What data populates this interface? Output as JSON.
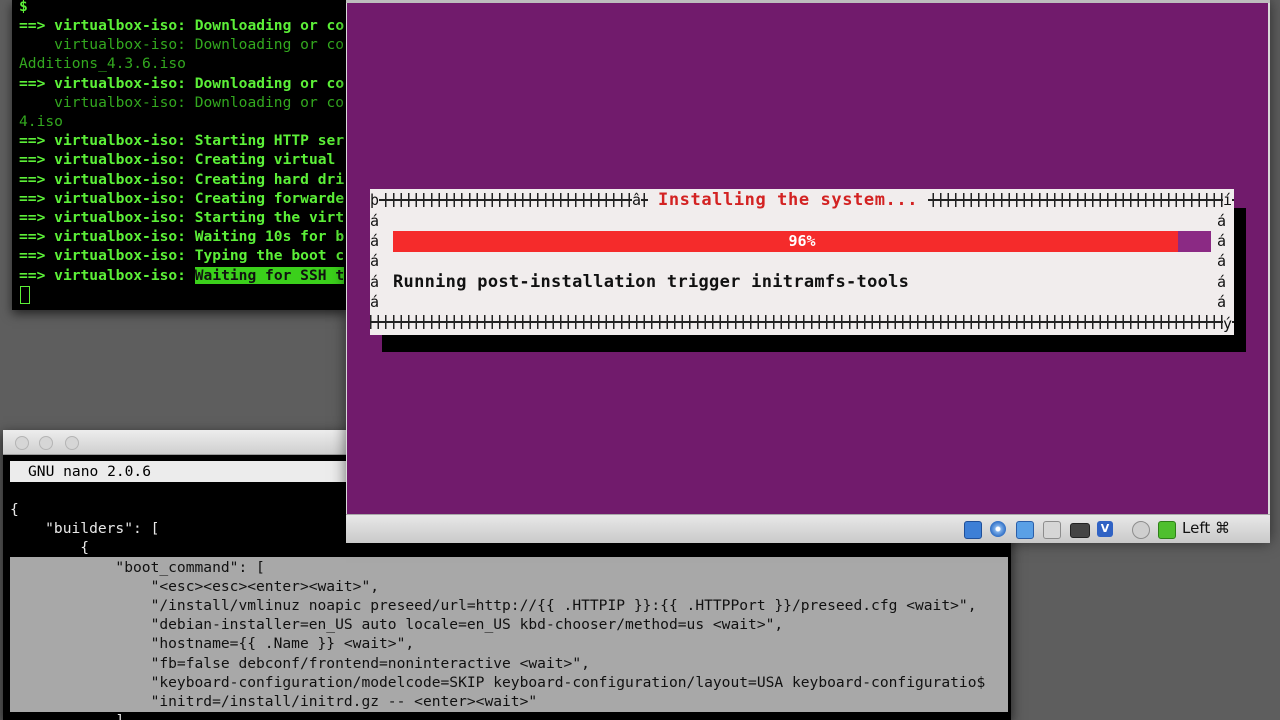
{
  "terminal_log": {
    "prompt": "$",
    "lines": [
      {
        "arrow": "==>",
        "text": "virtualbox-iso: Downloading or co"
      },
      {
        "arrow": "",
        "text": "    virtualbox-iso: Downloading or co"
      },
      {
        "arrow": "",
        "text": "Additions_4.3.6.iso"
      },
      {
        "arrow": "==>",
        "text": "virtualbox-iso: Downloading or co"
      },
      {
        "arrow": "",
        "text": "    virtualbox-iso: Downloading or co"
      },
      {
        "arrow": "",
        "text": "4.iso"
      },
      {
        "arrow": "==>",
        "text": "virtualbox-iso: Starting HTTP ser"
      },
      {
        "arrow": "==>",
        "text": "virtualbox-iso: Creating virtual "
      },
      {
        "arrow": "==>",
        "text": "virtualbox-iso: Creating hard dri"
      },
      {
        "arrow": "==>",
        "text": "virtualbox-iso: Creating forwarde"
      },
      {
        "arrow": "==>",
        "text": "virtualbox-iso: Starting the virt"
      },
      {
        "arrow": "==>",
        "text": "virtualbox-iso: Waiting 10s for b"
      },
      {
        "arrow": "==>",
        "text": "virtualbox-iso: Typing the boot c"
      },
      {
        "arrow": "==>",
        "text": "virtualbox-iso: ",
        "highlight": "Waiting for SSH t"
      }
    ]
  },
  "nano": {
    "header": "GNU nano 2.0.6",
    "lines": [
      "{",
      "    \"builders\": [",
      "        {",
      "            \"boot_command\": [",
      "                \"<esc><esc><enter><wait>\",",
      "                \"/install/vmlinuz noapic preseed/url=http://{{ .HTTPIP }}:{{ .HTTPPort }}/preseed.cfg <wait>\",",
      "                \"debian-installer=en_US auto locale=en_US kbd-chooser/method=us <wait>\",",
      "                \"hostname={{ .Name }} <wait>\",",
      "                \"fb=false debconf/frontend=noninteractive <wait>\",",
      "                \"keyboard-configuration/modelcode=SKIP keyboard-configuration/layout=USA keyboard-configuratio$",
      "                \"initrd=/install/initrd.gz -- <enter><wait>\"",
      "            ],"
    ]
  },
  "installer": {
    "title": "Installing the system...",
    "progress_label": "96%",
    "progress": 0.96,
    "message": "Running post-installation trigger initramfs-tools",
    "corner_tl": "þ",
    "corner_tr": "í",
    "corner_br": "ý",
    "title_left_mark": "â",
    "side_char": "á"
  },
  "vbox_status": {
    "host_key": "Left ⌘",
    "icons": [
      "hard-disk-icon",
      "optical-drive-icon",
      "network-icon",
      "shared-folder-icon",
      "display-icon",
      "virtualization-icon",
      "mouse-integration-icon",
      "keyboard-capture-icon"
    ]
  },
  "colors": {
    "terminal_text": "#5cf038",
    "guest_background": "#711b6c",
    "progress_fill": "#f52b2b",
    "dialog_title": "#d32222"
  }
}
